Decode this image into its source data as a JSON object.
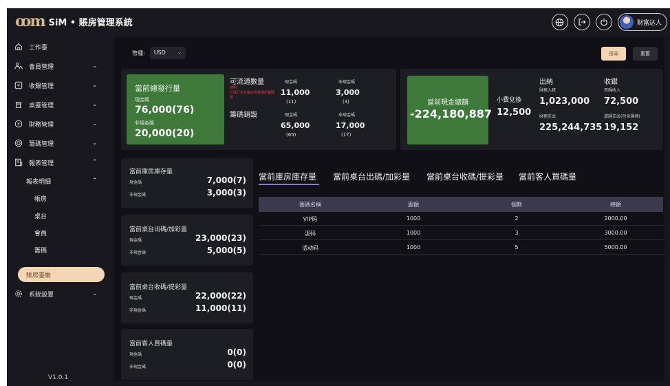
{
  "app": {
    "title": "SiM • 賬房管理系統",
    "logo": "SiM",
    "user": "财富达人"
  },
  "sidebar": {
    "items": [
      {
        "label": "工作臺",
        "icon": "home-icon"
      },
      {
        "label": "會員管理",
        "icon": "users-icon"
      },
      {
        "label": "收銀管理",
        "icon": "yen-icon"
      },
      {
        "label": "桌臺管理",
        "icon": "table-icon"
      },
      {
        "label": "財務管理",
        "icon": "finance-icon"
      },
      {
        "label": "籌碼管理",
        "icon": "chip-icon"
      },
      {
        "label": "報表管理",
        "icon": "report-icon"
      },
      {
        "label": "系統設置",
        "icon": "settings-icon"
      }
    ],
    "report_detail": "報表明細",
    "sub_items": [
      "帳房",
      "桌台",
      "會員",
      "籌碼"
    ],
    "active_item": "賬房臺帳",
    "version": "V1.0.1"
  },
  "filter": {
    "label": "幣種:",
    "currency": "USD",
    "search_label": "搜尋",
    "reset_label": "重置"
  },
  "issue_card": {
    "title": "當前總發行量",
    "cash_label": "現金碼",
    "cash_value": "76,000(76)",
    "noncash_label": "非現金碼",
    "noncash_value": "20,000(20)",
    "circ_label": "可流通數量",
    "circ_note1": "説明:",
    "circ_note2": "已發行未在帳房與帳場的籌碼",
    "circ_note3": "量",
    "chip_sales_label": "籌碼銷毀",
    "col_cash": "現金碼",
    "col_noncash": "非現金碼",
    "circ_cash": "11,000",
    "circ_cash_count": "(11)",
    "circ_noncash": "3,000",
    "circ_noncash_count": "(3)",
    "sales_cash": "65,000",
    "sales_cash_count": "(65)",
    "sales_noncash": "17,000",
    "sales_noncash_count": "(17)"
  },
  "cash_card": {
    "title": "當前現金總額",
    "total": "-224,180,887",
    "exchange_label": "小費兌換",
    "exchange_value": "12,500",
    "out_title": "出納",
    "out_income_label": "財務入賬",
    "out_income_value": "1,023,000",
    "out_expense_label": "財務支出",
    "out_expense_value": "225,244,735",
    "in_title": "收銀",
    "in_buy_label": "買碼收入",
    "in_buy_value": "72,500",
    "in_refund_label": "還碼支出(包含碼佣)",
    "in_refund_value": "19,152"
  },
  "stat_cards": [
    {
      "title": "當前庫房庫存量",
      "cash_label": "現金碼",
      "cash_value": "7,000(7)",
      "noncash_label": "非現金碼",
      "noncash_value": "3,000(3)"
    },
    {
      "title": "當前桌台出碼/加彩量",
      "cash_label": "現金碼",
      "cash_value": "23,000(23)",
      "noncash_label": "非現金碼",
      "noncash_value": "5,000(5)"
    },
    {
      "title": "當前桌台收碼/提彩量",
      "cash_label": "現金碼",
      "cash_value": "22,000(22)",
      "noncash_label": "非現金碼",
      "noncash_value": "11,000(11)"
    },
    {
      "title": "當前客人買碼量",
      "cash_label": "現金碼",
      "cash_value": "0(0)",
      "noncash_label": "非現金碼",
      "noncash_value": "0(0)"
    }
  ],
  "tabs": [
    "當前庫房庫存量",
    "當前桌台出碼/加彩量",
    "當前桌台收碼/提彩量",
    "當前客人買碼量"
  ],
  "table": {
    "headers": [
      "籌碼名稱",
      "面額",
      "個數",
      "總額"
    ],
    "rows": [
      [
        "VIP码",
        "1000",
        "2",
        "2000.00"
      ],
      [
        "泥码",
        "1000",
        "3",
        "3000.00"
      ],
      [
        "活动码",
        "1000",
        "5",
        "5000.00"
      ]
    ]
  }
}
